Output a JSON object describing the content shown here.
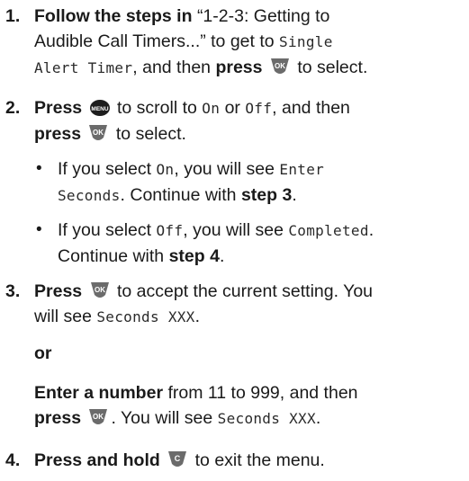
{
  "steps": [
    {
      "number": "1.",
      "action": "Follow the steps in",
      "quote": "“1-2-3: Getting to",
      "line2": "Audible Call Timers...” to get to",
      "lcd_menu": "Single",
      "lcd_menu2": "Alert Timer",
      "after_menu": ", and then",
      "press": "press",
      "select": "to select."
    },
    {
      "number": "2.",
      "press": "Press",
      "scroll": "to scroll to",
      "lcd_on": "On",
      "or": "or",
      "lcd_off": "Off",
      "then": ", and then",
      "press2": "press",
      "select": "to select.",
      "bullets": [
        {
          "pre": "If you select",
          "lcd_choice": "On",
          "mid": ", you will see",
          "lcd_result": "Enter",
          "lcd_result2": "Seconds",
          "post": ". Continue with",
          "step_ref": "step 3",
          "end": "."
        },
        {
          "pre": "If you select",
          "lcd_choice": "Off",
          "mid": ", you will see",
          "lcd_result": "Completed",
          "end": ".",
          "post": "Continue with",
          "step_ref": "step 4",
          "end2": "."
        }
      ]
    },
    {
      "number": "3.",
      "press": "Press",
      "accept": "to accept the current setting. You",
      "will_see": "will see",
      "lcd_seconds": "Seconds XXX",
      "period": ".",
      "or": "or",
      "enter": "Enter a number",
      "range": "from 11 to 999, and then",
      "press2": "press",
      "will_see2": ". You will see",
      "lcd_seconds2": "Seconds XXX",
      "period2": "."
    },
    {
      "number": "4.",
      "action": "Press and hold",
      "exit": "to exit the menu."
    }
  ],
  "keys": {
    "ok": "OK",
    "menu": "MENU",
    "clear": "C",
    "ok_color": "#6b6b6b",
    "menu_color": "#1e1e1e",
    "clear_color": "#6b6b6b"
  }
}
